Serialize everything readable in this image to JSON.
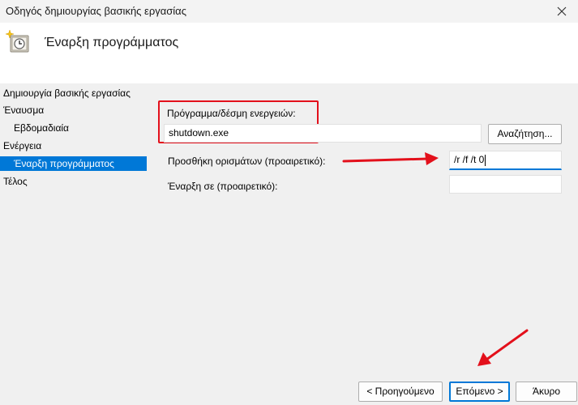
{
  "window": {
    "title": "Οδηγός δημιουργίας βασικής εργασίας",
    "close_icon": "close-icon"
  },
  "header": {
    "icon": "task-scheduler-clock-icon",
    "title": "Έναρξη προγράμματος"
  },
  "sidebar": {
    "items": [
      {
        "label": "Δημιουργία βασικής εργασίας",
        "selected": false
      },
      {
        "label": "Έναυσμα",
        "selected": false
      },
      {
        "label": "Εβδομαδιαία",
        "selected": false
      },
      {
        "label": "Ενέργεια",
        "selected": false
      },
      {
        "label": "Έναρξη προγράμματος",
        "selected": true
      },
      {
        "label": "Τέλος",
        "selected": false
      }
    ]
  },
  "form": {
    "program_label": "Πρόγραμμα/δέσμη ενεργειών:",
    "program_value": "shutdown.exe",
    "browse_label": "Αναζήτηση...",
    "arguments_label": "Προσθήκη ορισμάτων (προαιρετικό):",
    "arguments_value": "/r /f /t 0",
    "start_in_label": "Έναρξη σε (προαιρετικό):",
    "start_in_value": ""
  },
  "footer": {
    "back_label": "< Προηγούμενο",
    "next_label": "Επόμενο >",
    "cancel_label": "Άκυρο"
  },
  "annotations": {
    "highlight_color": "#e3101b",
    "accent_color": "#0078d7"
  }
}
